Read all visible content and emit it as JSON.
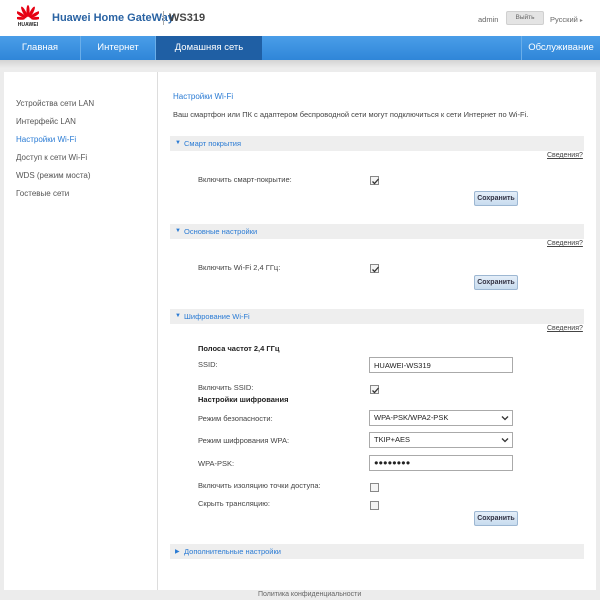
{
  "header": {
    "logo_text": "HUAWEI",
    "brand": "Huawei Home GateWay",
    "model": "WS319",
    "username": "admin",
    "logout_label": "Выйть",
    "language": "Русский",
    "brand_color": "#e60012"
  },
  "nav": {
    "items": [
      "Главная",
      "Интернет",
      "Домашняя сеть",
      "Обслуживание"
    ],
    "active": "Домашняя сеть",
    "color": "#2f86d8"
  },
  "sidebar": {
    "items": [
      "Устройства сети LAN",
      "Интерфейс LAN",
      "Настройки Wi-Fi",
      "Доступ к сети Wi-Fi",
      "WDS (режим моста)",
      "Гостевые сети"
    ],
    "active": "Настройки Wi-Fi"
  },
  "main": {
    "heading": "Настройки Wi-Fi",
    "description": "Ваш смартфон или ПК с адаптером беспроводной сети могут подключиться к сети Интернет по Wi-Fi.",
    "details_label": "Сведения?",
    "save_label": "Сохранить",
    "smart_coverage": {
      "title": "Смарт покрытия",
      "enable_label": "Включить смарт-покрытие:",
      "enabled": true
    },
    "basic": {
      "title": "Основные настройки",
      "enable_label": "Включить Wi-Fi 2,4 ГГц:",
      "enabled": true
    },
    "encryption": {
      "title": "Шифрование Wi-Fi",
      "band_label": "Полоса частот 2,4 ГГц",
      "ssid_label": "SSID:",
      "ssid_value": "HUAWEI-WS319",
      "enable_ssid_label": "Включить SSID:",
      "enable_ssid": true,
      "encryption_settings_label": "Настройки шифрования",
      "security_mode_label": "Режим безопасности:",
      "security_mode_value": "WPA-PSK/WPA2-PSK",
      "wpa_mode_label": "Режим шифрования WPA:",
      "wpa_mode_value": "TKIP+AES",
      "psk_label": "WPA-PSK:",
      "psk_value": "●●●●●●●●",
      "ap_isolation_label": "Включить изоляцию точки доступа:",
      "ap_isolation": false,
      "hide_broadcast_label": "Скрыть трансляцию:",
      "hide_broadcast": false
    },
    "advanced": {
      "title": "Дополнительные настройки"
    }
  },
  "footer": {
    "privacy_label": "Политика конфиденциальности"
  }
}
